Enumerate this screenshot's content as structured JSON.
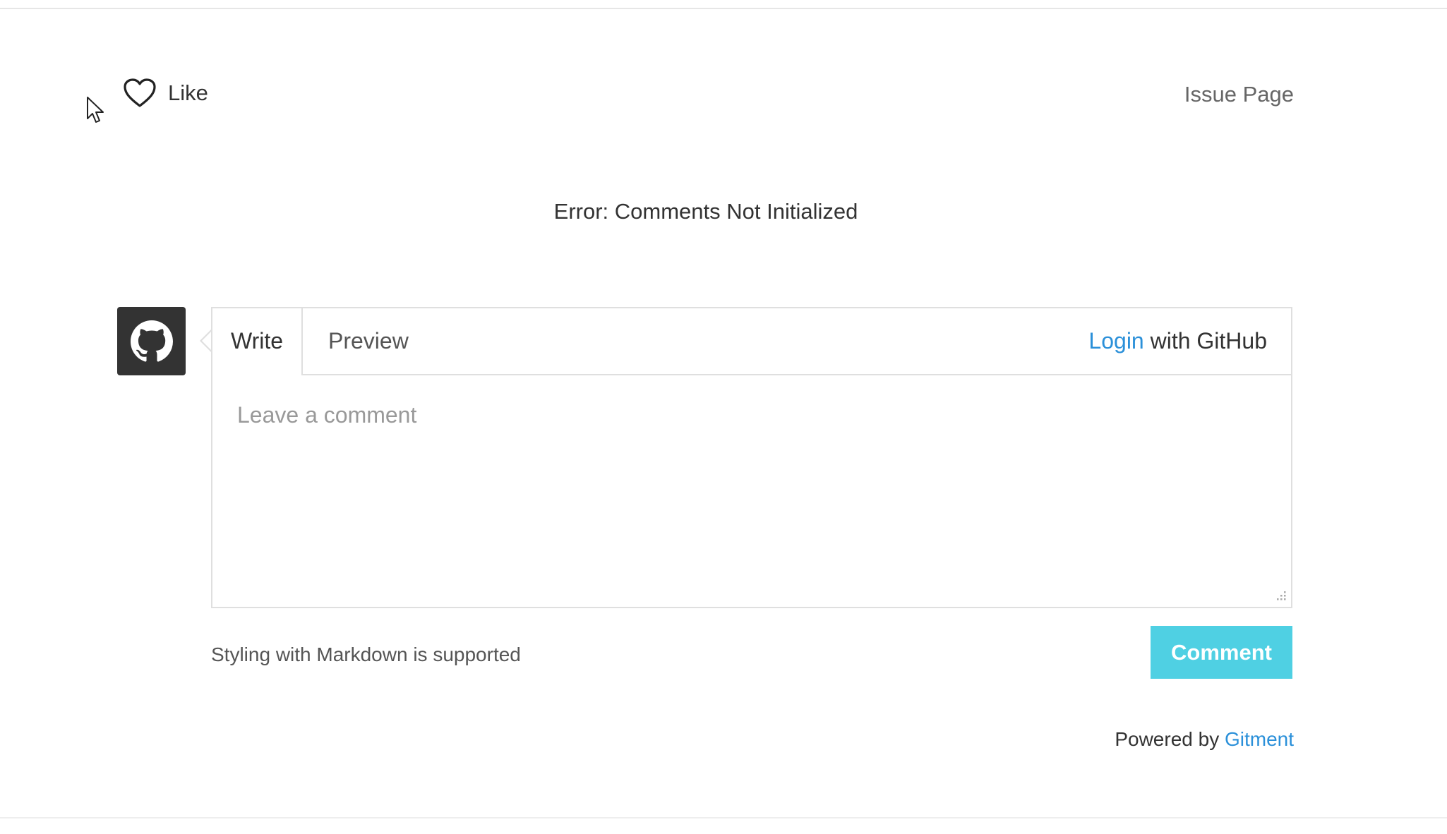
{
  "like": {
    "label": "Like",
    "icon": "heart-icon"
  },
  "issue_page": {
    "label": "Issue Page"
  },
  "error": {
    "message": "Error: Comments Not Initialized"
  },
  "avatar": {
    "icon": "github-icon",
    "background": "#333333"
  },
  "editor": {
    "tabs": [
      {
        "label": "Write",
        "active": true
      },
      {
        "label": "Preview",
        "active": false
      }
    ],
    "login": {
      "link_text": "Login",
      "suffix": " with GitHub"
    },
    "textarea": {
      "placeholder": "Leave a comment",
      "value": ""
    }
  },
  "footer": {
    "markdown_tip": "Styling with Markdown is supported",
    "comment_button": "Comment",
    "powered_prefix": "Powered by ",
    "powered_link": "Gitment"
  },
  "colors": {
    "link": "#2b90d9",
    "button": "#4fd0e3",
    "border": "#dfdfdf"
  }
}
